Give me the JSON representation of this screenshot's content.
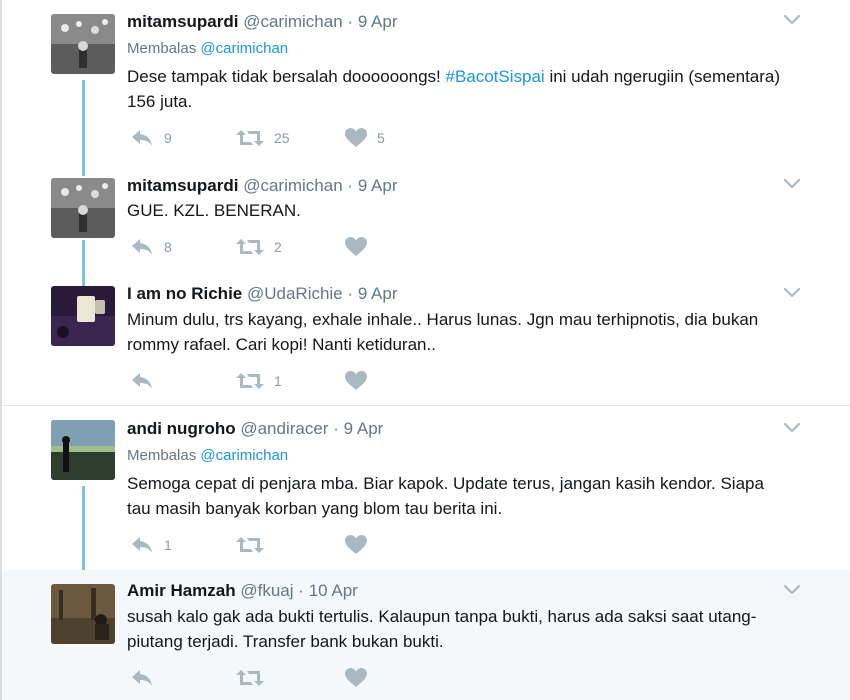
{
  "colors": {
    "link": "#1b95e0",
    "muted": "#657786",
    "thread": "#7ec0df",
    "icon": "#aab8c2"
  },
  "icons": {
    "reply": "reply-icon",
    "retweet": "retweet-icon",
    "like": "heart-icon",
    "more": "chevron-down-icon"
  },
  "tweets": [
    {
      "name": "mitamsupardi",
      "handle": "@carimichan",
      "dot": "·",
      "time": "9 Apr",
      "reply_prefix": "Membalas",
      "reply_mention": "@carimichan",
      "text_before": "Dese tampak tidak bersalah doooooongs! ",
      "hashtag": "#BacotSispai",
      "text_after": " ini udah ngerugiin (sementara) 156 juta.",
      "replies": "9",
      "retweets": "25",
      "likes": "5"
    },
    {
      "name": "mitamsupardi",
      "handle": "@carimichan",
      "dot": "·",
      "time": "9 Apr",
      "text": "GUE. KZL. BENERAN.",
      "replies": "8",
      "retweets": "2",
      "likes": ""
    },
    {
      "name": "I am no Richie",
      "handle": "@UdaRichie",
      "dot": "·",
      "time": "9 Apr",
      "text": "Minum dulu, trs kayang, exhale inhale.. Harus lunas. Jgn mau terhipnotis, dia bukan rommy rafael. Cari kopi! Nanti ketiduran..",
      "replies": "",
      "retweets": "1",
      "likes": ""
    },
    {
      "name": "andi nugroho",
      "handle": "@andiracer",
      "dot": "·",
      "time": "9 Apr",
      "reply_prefix": "Membalas",
      "reply_mention": "@carimichan",
      "text": "Semoga cepat di penjara mba. Biar kapok. Update terus, jangan kasih kendor. Siapa tau masih banyak korban yang blom tau berita ini.",
      "replies": "1",
      "retweets": "",
      "likes": ""
    },
    {
      "name": "Amir Hamzah",
      "handle": "@fkuaj",
      "dot": "·",
      "time": "10 Apr",
      "text": "susah kalo gak ada bukti tertulis. Kalaupun tanpa bukti, harus ada saksi saat utang-piutang terjadi. Transfer bank bukan bukti.",
      "replies": "",
      "retweets": "",
      "likes": ""
    }
  ]
}
